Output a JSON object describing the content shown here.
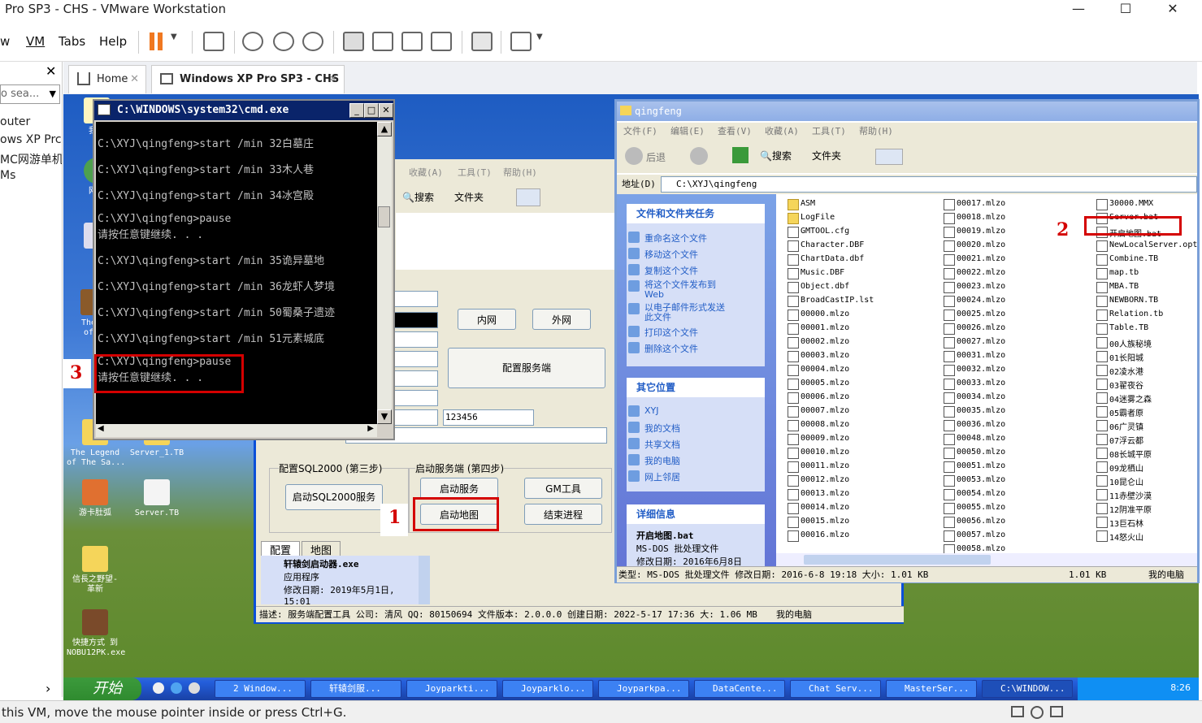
{
  "vmware": {
    "title": "Pro SP3 - CHS - VMware Workstation",
    "menu": [
      "w",
      "VM",
      "Tabs",
      "Help"
    ],
    "search_placeholder": "o sea...",
    "tabs": [
      {
        "label": "Home"
      },
      {
        "label": "Windows XP Pro SP3 - CHS"
      }
    ],
    "library": [
      "outer",
      "ows XP Prc",
      "MC网游单机",
      "Ms"
    ],
    "status": "this VM, move the mouse pointer inside or press Ctrl+G."
  },
  "desktop_icons": [
    {
      "label": "我的"
    },
    {
      "label": "网上"
    },
    {
      "label": "回"
    },
    {
      "label": "The I\nof T"
    },
    {
      "label": "The Legend\nof The Sa..."
    },
    {
      "label": "Server_1.TB"
    },
    {
      "label": "游卡肚弧"
    },
    {
      "label": "Server.TB"
    },
    {
      "label": "信長之野望-\n革新"
    },
    {
      "label": "快捷方式 到\nNOBU12PK.exe"
    }
  ],
  "cmd": {
    "title": "C:\\WINDOWS\\system32\\cmd.exe",
    "lines": [
      "C:\\XYJ\\qingfeng>start /min 32白墓庄",
      "C:\\XYJ\\qingfeng>start /min 33木人巷",
      "C:\\XYJ\\qingfeng>start /min 34冰宫殿",
      "C:\\XYJ\\qingfeng>pause",
      "请按任意键继续. . .",
      "C:\\XYJ\\qingfeng>start /min 35诡异墓地",
      "C:\\XYJ\\qingfeng>start /min 36龙虾人梦境",
      "C:\\XYJ\\qingfeng>start /min 50蜀桑子遗迹",
      "C:\\XYJ\\qingfeng>start /min 51元素城底",
      "C:\\XYJ\\qingfeng>pause",
      "请按任意键继续. . ."
    ]
  },
  "launcher": {
    "menu": [
      "收藏(A)",
      "工具(T)",
      "帮助(H)"
    ],
    "search": "搜索",
    "folders": "文件夹",
    "lan": "内网",
    "wan": "外网",
    "config_server": "配置服务端",
    "password": "123456",
    "sql_group": "配置SQL2000 (第三步)",
    "sql_btn": "启动SQL2000服务",
    "server_group": "启动服务端 (第四步)",
    "start_server": "启动服务",
    "gm_tool": "GM工具",
    "start_map": "启动地图",
    "end_process": "结束进程",
    "tab_config": "配置",
    "tab_map": "地图",
    "file_name": "轩辕剑启动器.exe",
    "file_type": "应用程序",
    "file_date": "修改日期: 2019年5月1日,\n15:01",
    "statusbar": "描述: 服务端配置工具 公司: 清风 QQ: 80150694 文件版本: 2.0.0.0 创建日期: 2022-5-17 17:36 大: 1.06 MB",
    "computer": "我的电脑"
  },
  "explorer": {
    "title": "qingfeng",
    "menu": [
      "文件(F)",
      "编辑(E)",
      "查看(V)",
      "收藏(A)",
      "工具(T)",
      "帮助(H)"
    ],
    "back": "后退",
    "search": "搜索",
    "folders": "文件夹",
    "address_label": "地址(D)",
    "address": "C:\\XYJ\\qingfeng",
    "tasks_title": "文件和文件夹任务",
    "tasks": [
      "重命名这个文件",
      "移动这个文件",
      "复制这个文件",
      "将这个文件发布到\nWeb",
      "以电子邮件形式发送\n此文件",
      "打印这个文件",
      "删除这个文件"
    ],
    "places_title": "其它位置",
    "places": [
      "XYJ",
      "我的文档",
      "共享文档",
      "我的电脑",
      "网上邻居"
    ],
    "details_title": "详细信息",
    "details_name": "开启地图.bat",
    "details_type": "MS-DOS 批处理文件",
    "details_date": "修改日期: 2016年6月8日",
    "col1": [
      "ASM",
      "LogFile",
      "GMTOOL.cfg",
      "Character.DBF",
      "ChartData.dbf",
      "Music.DBF",
      "Object.dbf",
      "BroadCastIP.lst",
      "00000.mlzo",
      "00001.mlzo",
      "00002.mlzo",
      "00003.mlzo",
      "00004.mlzo",
      "00005.mlzo",
      "00006.mlzo",
      "00007.mlzo",
      "00008.mlzo",
      "00009.mlzo",
      "00010.mlzo",
      "00011.mlzo",
      "00012.mlzo",
      "00013.mlzo",
      "00014.mlzo",
      "00015.mlzo",
      "00016.mlzo"
    ],
    "col2": [
      "00017.mlzo",
      "00018.mlzo",
      "00019.mlzo",
      "00020.mlzo",
      "00021.mlzo",
      "00022.mlzo",
      "00023.mlzo",
      "00024.mlzo",
      "00025.mlzo",
      "00026.mlzo",
      "00027.mlzo",
      "00031.mlzo",
      "00032.mlzo",
      "00033.mlzo",
      "00034.mlzo",
      "00035.mlzo",
      "00036.mlzo",
      "00048.mlzo",
      "00050.mlzo",
      "00051.mlzo",
      "00053.mlzo",
      "00054.mlzo",
      "00055.mlzo",
      "00056.mlzo",
      "00057.mlzo",
      "00058.mlzo"
    ],
    "col3": [
      "30000.MMX",
      "Server.bat",
      "开启地图.bat",
      "NewLocalServer.opt",
      "Combine.TB",
      "map.tb",
      "MBA.TB",
      "NEWBORN.TB",
      "Relation.tb",
      "Table.TB",
      "00人族秘境",
      "01长阳城",
      "02凌水港",
      "03翟夜谷",
      "04迷雾之森",
      "05霸者原",
      "06广灵镇",
      "07浮云都",
      "08长城平原",
      "09龙栖山",
      "10昆仑山",
      "11赤壁沙漠",
      "12阴准平原",
      "13巨石林",
      "14怒火山"
    ],
    "status": "类型: MS-DOS 批处理文件 修改日期: 2016-6-8 19:18 大小: 1.01 KB",
    "size": "1.01 KB",
    "computer": "我的电脑"
  },
  "annotations": [
    "1",
    "2",
    "3"
  ],
  "taskbar": {
    "start": "开始",
    "tasks": [
      "2 Window...",
      "轩辕剑服...",
      "Joyparkti...",
      "Joyparklo...",
      "Joyparkpa...",
      "DataCente...",
      "Chat Serv...",
      "MasterSer...",
      "C:\\WINDOW..."
    ],
    "clock": "8:26"
  }
}
